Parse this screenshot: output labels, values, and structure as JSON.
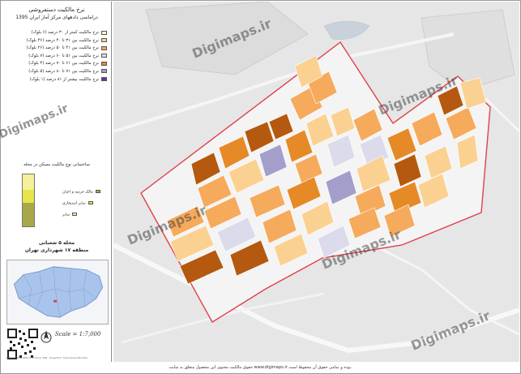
{
  "title": {
    "line1": "نرخ مالکیت دستفروشی",
    "line2": "دراماسی دادههای مرکز آمار ایران 1395"
  },
  "legend": {
    "items": [
      {
        "label": "نرخ مالکیت کمتر از ۳۰ درصد (۶ بلوک)",
        "color": "#fff6d5"
      },
      {
        "label": "نرخ مالکیت بین ۳۱ تا ۴۰ درصد (۴۶ بلوک)",
        "color": "#fbd192"
      },
      {
        "label": "نرخ مالکیت بین ۴۱ تا ۵۰ درصد (۲۶ بلوک)",
        "color": "#f5aa5c"
      },
      {
        "label": "نرخ مالکیت بین ۵۱ تا ۶۰ درصد (۷ بلوک)",
        "color": "#dcdbeb"
      },
      {
        "label": "نرخ مالکیت بین ۶۱ تا ۷۰ درصد (۴ بلوک)",
        "color": "#e58a27"
      },
      {
        "label": "نرخ مالکیت بین ۷۱ تا ۸۰ درصد (۵ بلوک)",
        "color": "#a49ecb"
      },
      {
        "label": "نرخ مالکیت بیشتر از ۸۱ درصد (۱ بلوک)",
        "color": "#5e3c91"
      }
    ]
  },
  "ownership_chart": {
    "title": "ساختمانی نوع مالکیت مسکن در محله",
    "segments": [
      {
        "label": "مالک عرصه و اعیان",
        "color": "#a8a84a",
        "share": 0.45
      },
      {
        "label": "سایر استیجاری",
        "color": "#e6e64a",
        "share": 0.25
      },
      {
        "label": "سایر",
        "color": "#f4f19a",
        "share": 0.3
      }
    ]
  },
  "inset": {
    "line1": "محله ۵ شعبانی",
    "line2": "منطقه ۱۷ شهرداری تهران"
  },
  "scale": "Scale = 1:7,000",
  "credit": "Datum: WGS1984 UTM Zone 39N - Projection: Transverse Mercator",
  "watermark": "Digimaps.ir",
  "copyright": "حقوق مالکیت محتوی این محصول متعلق به سایت www.digimaps.ir بوده و تمامی حقوق آن محفوظ است.",
  "colors": {
    "boundary": "#e0404a",
    "light": "#fbd192",
    "mid": "#f5aa5c",
    "dark_orange": "#e58a27",
    "brown": "#b4590f",
    "lavender": "#dcdbeb",
    "purple_light": "#a49ecb",
    "basemap": "#e6e6e6"
  }
}
